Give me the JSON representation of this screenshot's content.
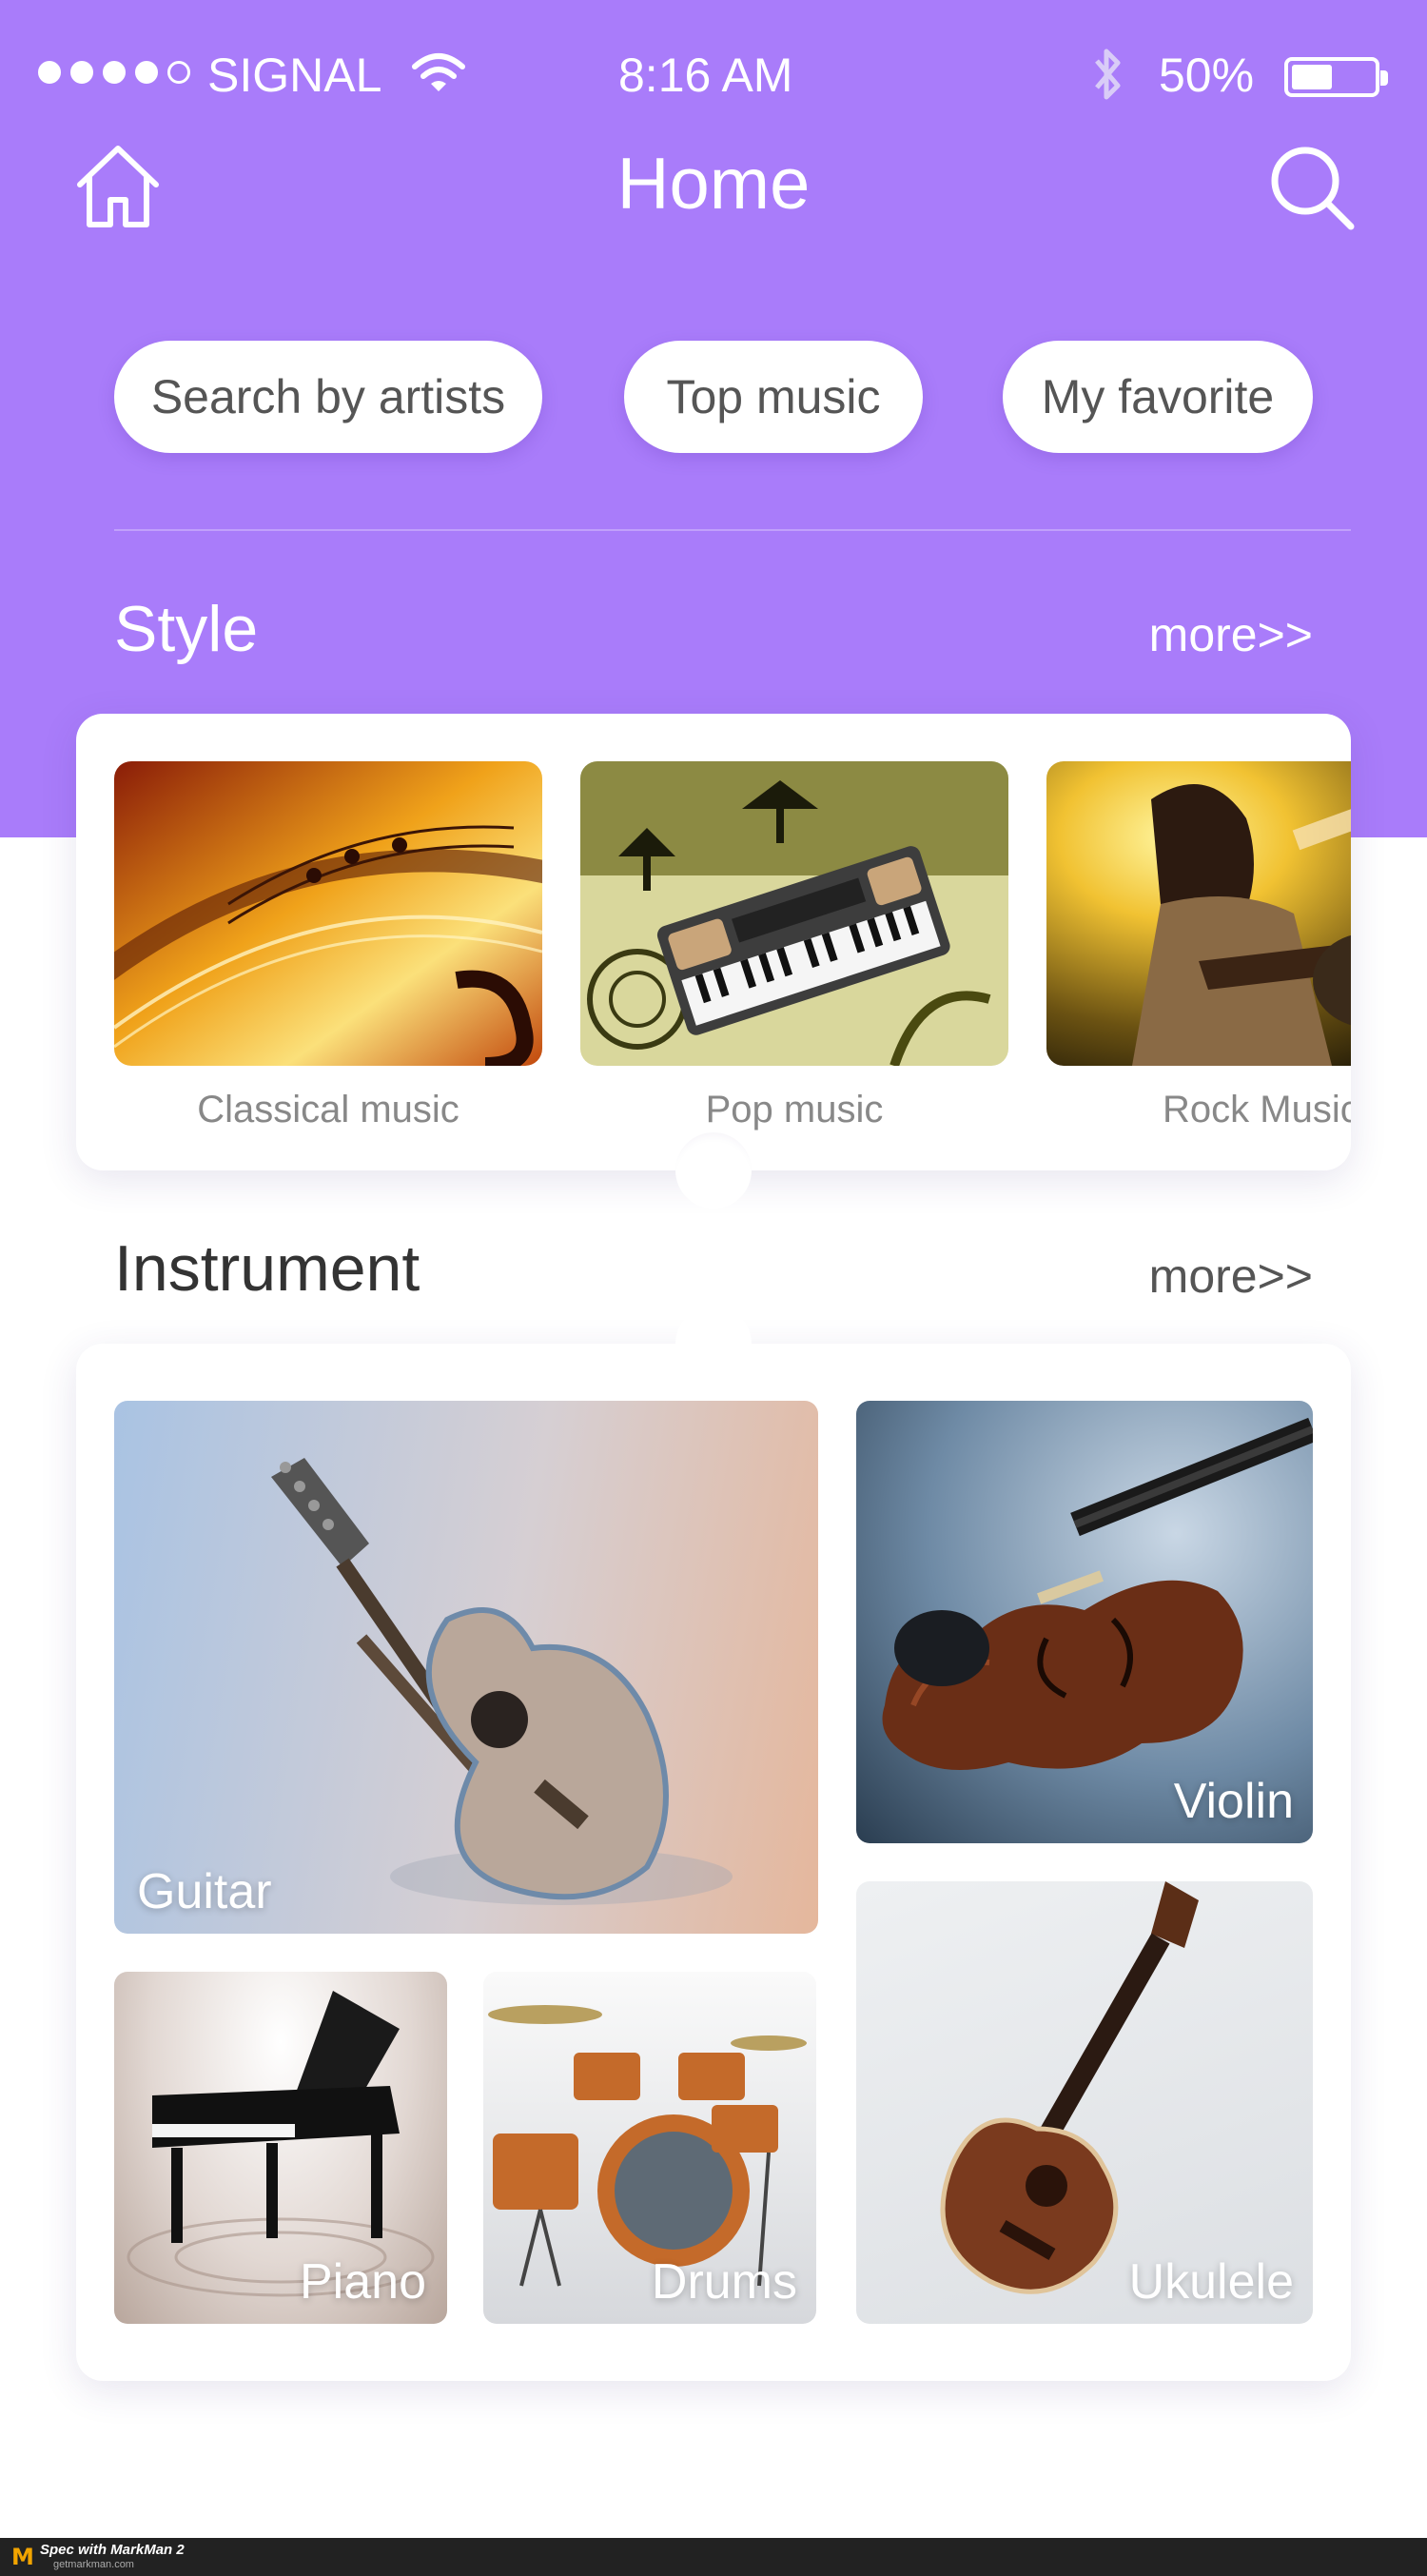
{
  "status_bar": {
    "carrier": "SIGNAL",
    "time": "8:16 AM",
    "battery_percent": "50%",
    "battery_level": 0.5,
    "signal_dots": [
      true,
      true,
      true,
      true,
      false
    ]
  },
  "nav": {
    "title": "Home",
    "left_icon": "home-icon",
    "right_icon": "search-icon"
  },
  "filters": {
    "items": [
      {
        "label": "Search by artists"
      },
      {
        "label": "Top music"
      },
      {
        "label": "My favorite"
      }
    ]
  },
  "style_section": {
    "title": "Style",
    "more": "more>>",
    "items": [
      {
        "label": "Classical music"
      },
      {
        "label": "Pop music"
      },
      {
        "label": "Rock Music"
      }
    ]
  },
  "instrument_section": {
    "title": "Instrument",
    "more": "more>>",
    "items": [
      {
        "label": "Guitar"
      },
      {
        "label": "Violin"
      },
      {
        "label": "Piano"
      },
      {
        "label": "Drums"
      },
      {
        "label": "Ukulele"
      }
    ]
  },
  "footer": {
    "brand": "Spec with MarkMan 2",
    "site": "getmarkman.com",
    "logo_letter": "M"
  },
  "colors": {
    "primary": "#a97cfa",
    "text_dark": "#333333",
    "text_muted": "#888888"
  }
}
